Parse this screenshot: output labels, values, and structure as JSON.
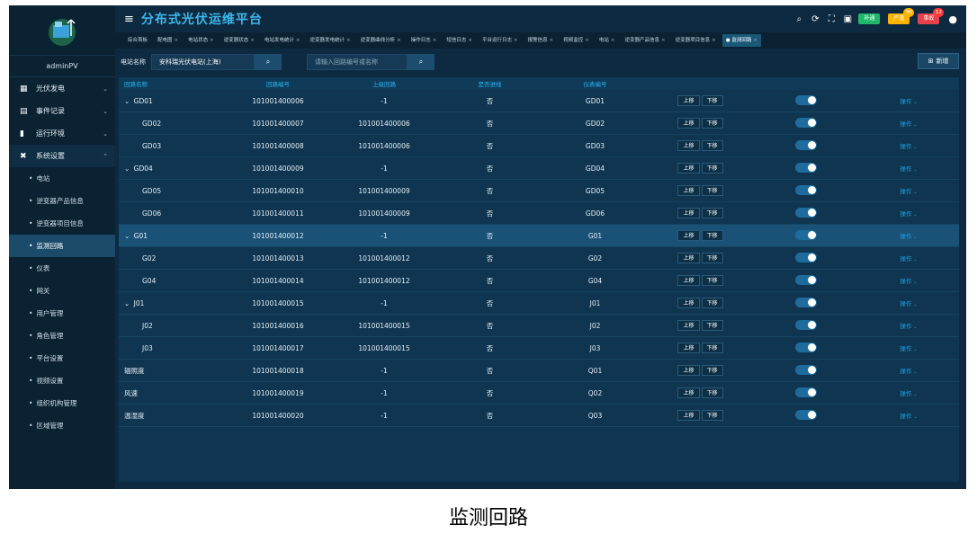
{
  "app": {
    "title": "分布式光伏运维平台",
    "user": "adminPV"
  },
  "topbar": {
    "badges": [
      {
        "label": "补通",
        "count": "",
        "color": "#1fb86b"
      },
      {
        "label": "严重",
        "count": "96",
        "color": "#ffb400"
      },
      {
        "label": "事故",
        "count": "12",
        "color": "#e7414c"
      }
    ]
  },
  "tabs": [
    {
      "label": "综合首板",
      "active": false,
      "closable": false
    },
    {
      "label": "配电图",
      "active": false,
      "closable": true
    },
    {
      "label": "电站状态",
      "active": false,
      "closable": true
    },
    {
      "label": "逆变器状态",
      "active": false,
      "closable": true
    },
    {
      "label": "电站发电统计",
      "active": false,
      "closable": true
    },
    {
      "label": "逆变器发电统计",
      "active": false,
      "closable": true
    },
    {
      "label": "逆变器曲线分析",
      "active": false,
      "closable": true
    },
    {
      "label": "操作日志",
      "active": false,
      "closable": true
    },
    {
      "label": "短信日志",
      "active": false,
      "closable": true
    },
    {
      "label": "平台运行日志",
      "active": false,
      "closable": true
    },
    {
      "label": "报警信息",
      "active": false,
      "closable": true
    },
    {
      "label": "视频监控",
      "active": false,
      "closable": true
    },
    {
      "label": "电站",
      "active": false,
      "closable": true
    },
    {
      "label": "逆变器产品信息",
      "active": false,
      "closable": true
    },
    {
      "label": "逆变器项目信息",
      "active": false,
      "closable": true
    },
    {
      "label": "● 监测回路",
      "active": true,
      "closable": true
    }
  ],
  "sidebar": {
    "groups": [
      {
        "label": "光伏发电",
        "icon": "grid-icon",
        "open": false
      },
      {
        "label": "事件记录",
        "icon": "doc-icon",
        "open": false
      },
      {
        "label": "运行环境",
        "icon": "env-icon",
        "open": false
      },
      {
        "label": "系统设置",
        "icon": "tools-icon",
        "open": true,
        "items": [
          {
            "label": "电站",
            "active": false
          },
          {
            "label": "逆变器产品信息",
            "active": false
          },
          {
            "label": "逆变器项目信息",
            "active": false
          },
          {
            "label": "监测回路",
            "active": true
          },
          {
            "label": "仪表",
            "active": false
          },
          {
            "label": "网关",
            "active": false
          },
          {
            "label": "用户管理",
            "active": false
          },
          {
            "label": "角色管理",
            "active": false
          },
          {
            "label": "平台设置",
            "active": false
          },
          {
            "label": "视频设置",
            "active": false
          },
          {
            "label": "组织机构管理",
            "active": false
          },
          {
            "label": "区域管理",
            "active": false
          }
        ]
      }
    ]
  },
  "filters": {
    "station_label": "电站名称",
    "station_value": "安科瑞光伏电站(上海)",
    "search_placeholder": "请输入回路编号或名称",
    "add_label": "新增"
  },
  "table": {
    "columns": [
      "回路名称",
      "回路编号",
      "上级回路",
      "是否进线",
      "仪表编号",
      "",
      "",
      ""
    ],
    "move_up": "上移",
    "move_down": "下移",
    "action": "操作",
    "rows": [
      {
        "name": "GD01",
        "code": "101001400006",
        "parent": "-1",
        "incoming": "否",
        "meter": "GD01",
        "level": 0,
        "expand": true,
        "sel": false
      },
      {
        "name": "GD02",
        "code": "101001400007",
        "parent": "101001400006",
        "incoming": "否",
        "meter": "GD02",
        "level": 1,
        "expand": false,
        "sel": false
      },
      {
        "name": "GD03",
        "code": "101001400008",
        "parent": "101001400006",
        "incoming": "否",
        "meter": "GD03",
        "level": 1,
        "expand": false,
        "sel": false
      },
      {
        "name": "GD04",
        "code": "101001400009",
        "parent": "-1",
        "incoming": "否",
        "meter": "GD04",
        "level": 0,
        "expand": true,
        "sel": false
      },
      {
        "name": "GD05",
        "code": "101001400010",
        "parent": "101001400009",
        "incoming": "否",
        "meter": "GD05",
        "level": 1,
        "expand": false,
        "sel": false
      },
      {
        "name": "GD06",
        "code": "101001400011",
        "parent": "101001400009",
        "incoming": "否",
        "meter": "GD06",
        "level": 1,
        "expand": false,
        "sel": false
      },
      {
        "name": "G01",
        "code": "101001400012",
        "parent": "-1",
        "incoming": "否",
        "meter": "G01",
        "level": 0,
        "expand": true,
        "sel": true
      },
      {
        "name": "G02",
        "code": "101001400013",
        "parent": "101001400012",
        "incoming": "否",
        "meter": "G02",
        "level": 1,
        "expand": false,
        "sel": false
      },
      {
        "name": "G04",
        "code": "101001400014",
        "parent": "101001400012",
        "incoming": "否",
        "meter": "G04",
        "level": 1,
        "expand": false,
        "sel": false
      },
      {
        "name": "J01",
        "code": "101001400015",
        "parent": "-1",
        "incoming": "否",
        "meter": "J01",
        "level": 0,
        "expand": true,
        "sel": false
      },
      {
        "name": "J02",
        "code": "101001400016",
        "parent": "101001400015",
        "incoming": "否",
        "meter": "J02",
        "level": 1,
        "expand": false,
        "sel": false
      },
      {
        "name": "J03",
        "code": "101001400017",
        "parent": "101001400015",
        "incoming": "否",
        "meter": "J03",
        "level": 1,
        "expand": false,
        "sel": false
      },
      {
        "name": "辐照度",
        "code": "101001400018",
        "parent": "-1",
        "incoming": "否",
        "meter": "Q01",
        "level": -1,
        "expand": false,
        "sel": false
      },
      {
        "name": "风速",
        "code": "101001400019",
        "parent": "-1",
        "incoming": "否",
        "meter": "Q02",
        "level": -1,
        "expand": false,
        "sel": false
      },
      {
        "name": "温湿度",
        "code": "101001400020",
        "parent": "-1",
        "incoming": "否",
        "meter": "Q03",
        "level": -1,
        "expand": false,
        "sel": false
      }
    ]
  },
  "caption": "监测回路"
}
